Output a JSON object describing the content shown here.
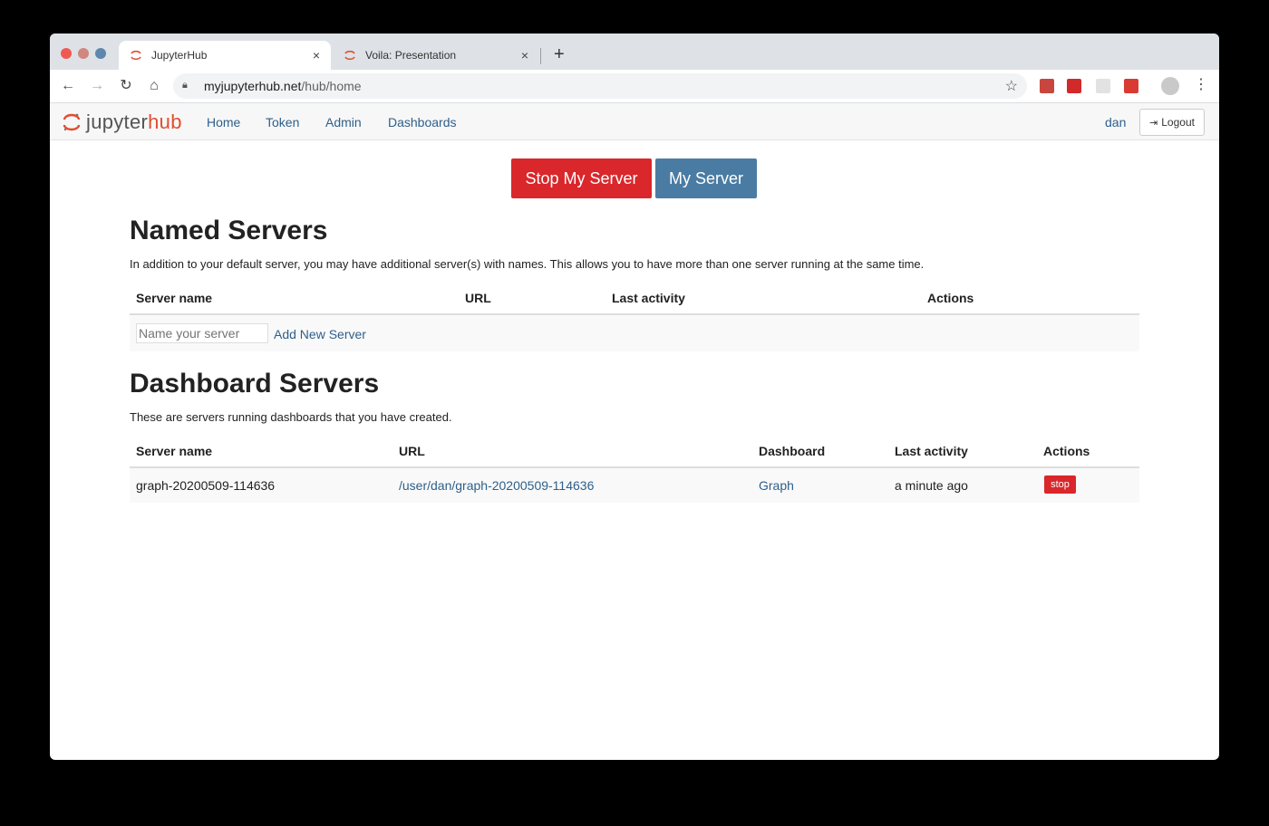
{
  "browser": {
    "tabs": [
      {
        "title": "JupyterHub",
        "active": true
      },
      {
        "title": "Voila: Presentation",
        "active": false
      }
    ],
    "new_tab": "+",
    "close_glyph": "×",
    "url_host": "myjupyterhub.net",
    "url_path": "/hub/home"
  },
  "hub": {
    "logo_prefix": "jupyter",
    "logo_suffix": "hub",
    "nav": [
      "Home",
      "Token",
      "Admin",
      "Dashboards"
    ],
    "user": "dan",
    "logout_label": "Logout"
  },
  "actions": {
    "stop_label": "Stop My Server",
    "my_server_label": "My Server"
  },
  "named": {
    "heading": "Named Servers",
    "description": "In addition to your default server, you may have additional server(s) with names. This allows you to have more than one server running at the same time.",
    "columns": [
      "Server name",
      "URL",
      "Last activity",
      "Actions"
    ],
    "input_placeholder": "Name your server",
    "add_label": "Add New Server"
  },
  "dashboards": {
    "heading": "Dashboard Servers",
    "description": "These are servers running dashboards that you have created.",
    "columns": [
      "Server name",
      "URL",
      "Dashboard",
      "Last activity",
      "Actions"
    ],
    "rows": [
      {
        "server_name": "graph-20200509-114636",
        "url": "/user/dan/graph-20200509-114636",
        "dashboard": "Graph",
        "last_activity": "a minute ago",
        "action": "stop"
      }
    ]
  },
  "colors": {
    "danger": "#d9272b",
    "primary": "#4a7ca3",
    "link": "#2e5f8a",
    "brand": "#e34d2f"
  }
}
